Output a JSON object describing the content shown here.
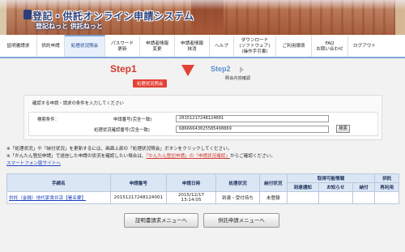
{
  "header": {
    "title": "登記・供託オンライン申請システム",
    "subtitle": "登記ねっと 供託ねっと"
  },
  "nav": {
    "items": [
      {
        "label": "証明書請求"
      },
      {
        "label": "供託申請"
      },
      {
        "label": "処理状況照会"
      },
      {
        "label": "パスワード\n更新"
      },
      {
        "label": "申請者情報\n変更"
      },
      {
        "label": "申請者情報\n抹消"
      },
      {
        "label": "ヘルプ"
      },
      {
        "label": "ダウンロード\n(ソフトウェア)\n(操作手引書)"
      },
      {
        "label": "ご利用環境"
      },
      {
        "label": "FAQ\nお問い合わせ"
      },
      {
        "label": "ログアウト"
      }
    ]
  },
  "steps": {
    "step1": "Step1",
    "step1_label": "処理状況照会",
    "step2": "Step2",
    "step2_label": "照会内容確認"
  },
  "conditions": {
    "intro": "確認する申請・請求の条件を入力してください",
    "search_condition_label": "検索条件：",
    "application_number_label": "申請番号(完全一致)",
    "application_number_value": "20151217248124001",
    "confirmation_number_label": "処理状況確認番号(完全一致)",
    "confirmation_number_value": "68666643025585490869",
    "search_button": "検索"
  },
  "notes": {
    "line1": "※「処理状況」や「納付状況」を更新するには、画面上部の「処理状況照会」ボタンをクリックしてください。",
    "line2_a": "※「かんたん登記申請」で送信した申請の状況を確認したい場合は、",
    "line2_link": "「かんたん登記申請」の「申請状況確認」",
    "line2_b": "からご確認ください。",
    "smartphone_link": "スマートフォン版サイトへ"
  },
  "table": {
    "headers": {
      "procedure": "手続名",
      "application_number": "申請番号",
      "date": "申請日時",
      "status": "処理状況",
      "payment": "納付状況",
      "acquirable": "取得可能情報",
      "deposit": "供託",
      "arrival": "到達通知",
      "notice": "お知らせ",
      "pay": "納付",
      "reacquire": "再利用"
    },
    "rows": [
      {
        "procedure": "供託（金銭）地代家賃弁済【署名要】",
        "application_number": "20151217248124001",
        "date": "2015/12/17 13:14:05",
        "status": "到達・受付待ち",
        "payment": "未登録",
        "arrival": "",
        "notice": "",
        "pay": "",
        "reacquire": ""
      }
    ]
  },
  "buttons": {
    "certificate_menu": "証明書請求メニューへ",
    "deposit_menu": "供託申請メニューへ"
  }
}
